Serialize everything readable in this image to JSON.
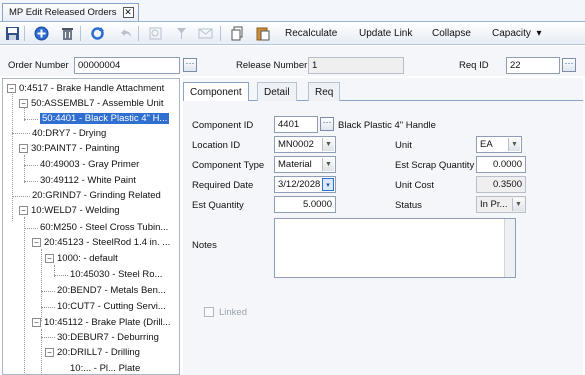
{
  "doc_tab": {
    "title": "MP Edit Released Orders",
    "close_glyph": "✕"
  },
  "toolbar": {
    "recalculate": "Recalculate",
    "update_link": "Update Link",
    "collapse": "Collapse",
    "capacity": "Capacity",
    "capacity_arrow": "▾"
  },
  "header": {
    "order_number_label": "Order Number",
    "order_number_value": "00000004",
    "release_number_label": "Release Number",
    "release_number_value": "1",
    "req_id_label": "Req ID",
    "req_id_value": "22",
    "ellipsis": "···"
  },
  "tree": {
    "expander_minus": "−",
    "nodes": [
      {
        "label": "0:4517 - Brake Handle Attachment"
      },
      {
        "label": "50:ASSEMBL7 - Assemble Unit"
      },
      {
        "label": "50:4401 - Black Plastic 4\" H..."
      },
      {
        "label": "40:DRY7 - Drying"
      },
      {
        "label": "30:PAINT7 - Painting"
      },
      {
        "label": "40:49003 - Gray Primer"
      },
      {
        "label": "30:49112 - White Paint"
      },
      {
        "label": "20:GRIND7 - Grinding Related"
      },
      {
        "label": "10:WELD7 - Welding"
      },
      {
        "label": "60:M250 - Steel Cross Tubin..."
      },
      {
        "label": "20:45123 - SteelRod 1.4 in. ..."
      },
      {
        "label": "1000: - default"
      },
      {
        "label": "10:45030 - Steel Ro..."
      },
      {
        "label": "20:BEND7 - Metals Ben..."
      },
      {
        "label": "10:CUT7 - Cutting Servi..."
      },
      {
        "label": "10:45112 - Brake Plate (Drill..."
      },
      {
        "label": "30:DEBUR7 - Deburring"
      },
      {
        "label": "20:DRILL7 - Drilling"
      },
      {
        "label": "10:... - Pl... Plate"
      }
    ]
  },
  "detail_tabs": [
    "Component",
    "Detail",
    "Req"
  ],
  "component": {
    "component_id_label": "Component ID",
    "component_id_value": "4401",
    "component_desc": "Black Plastic 4\" Handle",
    "location_id_label": "Location ID",
    "location_id_value": "MN0002",
    "unit_label": "Unit",
    "unit_value": "EA",
    "component_type_label": "Component Type",
    "component_type_value": "Material",
    "est_scrap_label": "Est Scrap Quantity",
    "est_scrap_value": "0.0000",
    "required_date_label": "Required Date",
    "required_date_value": "3/12/2028",
    "unit_cost_label": "Unit Cost",
    "unit_cost_value": "0.3500",
    "est_quantity_label": "Est Quantity",
    "est_quantity_value": "5.0000",
    "status_label": "Status",
    "status_value": "In Pr...",
    "notes_label": "Notes",
    "notes_value": "",
    "linked_label": "Linked",
    "dropdown_arrow": "▼",
    "calendar_glyph": "▾"
  }
}
